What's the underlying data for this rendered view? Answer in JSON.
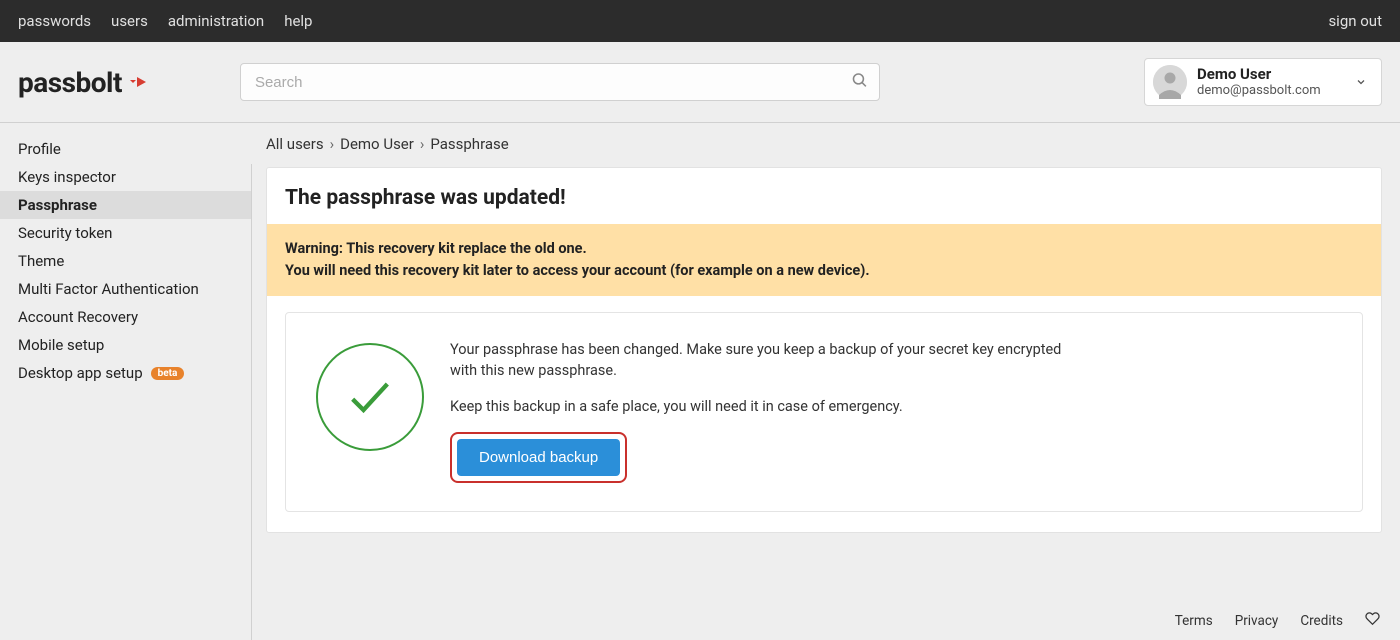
{
  "topbar": {
    "items": [
      "passwords",
      "users",
      "administration",
      "help"
    ],
    "signout": "sign out"
  },
  "logo_text": "passbolt",
  "search": {
    "placeholder": "Search"
  },
  "user": {
    "name": "Demo User",
    "email": "demo@passbolt.com"
  },
  "sidebar": {
    "items": [
      {
        "label": "Profile"
      },
      {
        "label": "Keys inspector"
      },
      {
        "label": "Passphrase",
        "active": true
      },
      {
        "label": "Security token"
      },
      {
        "label": "Theme"
      },
      {
        "label": "Multi Factor Authentication"
      },
      {
        "label": "Account Recovery"
      },
      {
        "label": "Mobile setup"
      },
      {
        "label": "Desktop app setup",
        "beta": true
      }
    ],
    "beta_label": "beta"
  },
  "breadcrumb": {
    "parts": [
      "All users",
      "Demo User",
      "Passphrase"
    ]
  },
  "panel": {
    "title": "The passphrase was updated!",
    "warning_line1": "Warning: This recovery kit replace the old one.",
    "warning_line2": "You will need this recovery kit later to access your account (for example on a new device).",
    "body_p1": "Your passphrase has been changed. Make sure you keep a backup of your secret key encrypted with this new passphrase.",
    "body_p2": "Keep this backup in a safe place, you will need it in case of emergency.",
    "download_label": "Download backup"
  },
  "footer": {
    "terms": "Terms",
    "privacy": "Privacy",
    "credits": "Credits"
  }
}
